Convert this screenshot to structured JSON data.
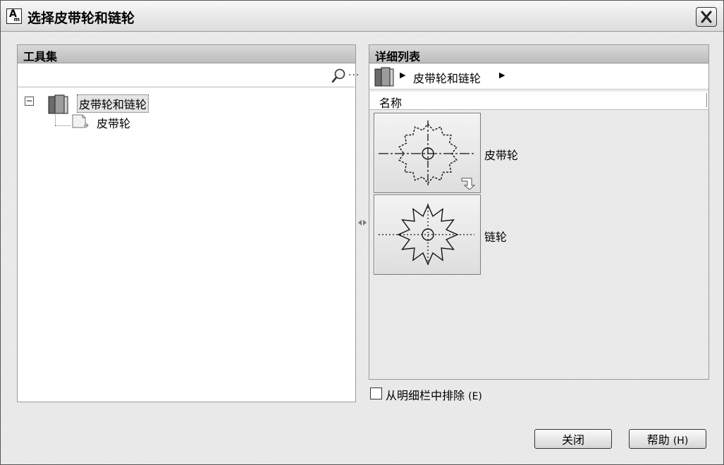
{
  "window": {
    "title": "选择皮带轮和链轮",
    "app_icon_letter": "A",
    "app_icon_sub": "m"
  },
  "left_panel": {
    "header": "工具集",
    "search": {
      "value": "",
      "placeholder": "",
      "more": "..."
    },
    "tree": {
      "expander": "−",
      "root_label": "皮带轮和链轮",
      "children": [
        {
          "label": "皮带轮"
        }
      ]
    }
  },
  "right_panel": {
    "header": "详细列表",
    "breadcrumb": {
      "label": "皮带轮和链轮"
    },
    "column_header": "名称",
    "items": [
      {
        "label": "皮带轮"
      },
      {
        "label": "链轮"
      }
    ]
  },
  "exclude_checkbox": {
    "label": "从明细栏中排除",
    "shortcut": "(E)",
    "checked": false
  },
  "buttons": {
    "close_label": "关闭",
    "help_label": "帮助",
    "help_shortcut": "(H)"
  },
  "icons": {
    "title_app": "autocad-mechanical-icon",
    "title_close": "close-icon",
    "search": "search-icon",
    "tree_root": "book-icon",
    "tree_child": "page-icon",
    "breadcrumb": "book-icon",
    "item_overlay": "insert-arrow-icon"
  }
}
